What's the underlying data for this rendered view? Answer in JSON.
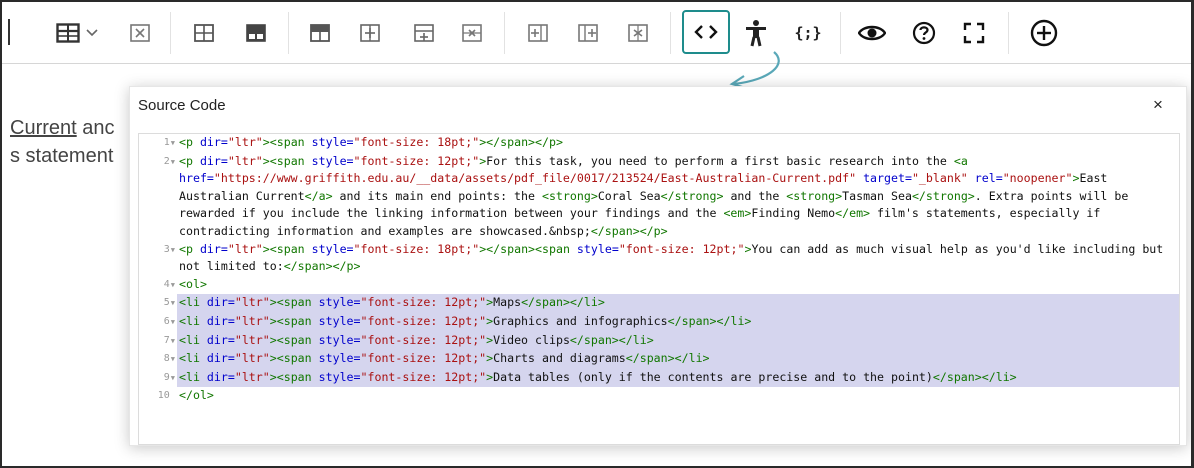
{
  "toolbar": {
    "buttons": [
      {
        "name": "table-icon",
        "title": "Table"
      },
      {
        "name": "delete-table-icon",
        "title": "Delete table"
      },
      {
        "name": "table-cell-properties-icon",
        "title": "Cell properties"
      },
      {
        "name": "table-merge-cells-icon",
        "title": "Merge cells"
      },
      {
        "name": "table-insert-row-before-icon",
        "title": "Insert row before"
      },
      {
        "name": "table-insert-row-after-icon",
        "title": "Insert row after"
      },
      {
        "name": "table-split-cells-icon",
        "title": "Split cells"
      },
      {
        "name": "table-delete-row-icon",
        "title": "Delete row"
      },
      {
        "name": "table-insert-column-before-icon",
        "title": "Insert column before"
      },
      {
        "name": "table-insert-column-after-icon",
        "title": "Insert column after"
      },
      {
        "name": "table-delete-column-icon",
        "title": "Delete column"
      },
      {
        "name": "source-code-icon",
        "title": "Source code"
      },
      {
        "name": "accessibility-icon",
        "title": "Accessibility"
      },
      {
        "name": "code-sample-icon",
        "title": "Code sample"
      },
      {
        "name": "preview-icon",
        "title": "Preview"
      },
      {
        "name": "help-icon",
        "title": "Help"
      },
      {
        "name": "fullscreen-icon",
        "title": "Fullscreen"
      },
      {
        "name": "add-icon",
        "title": "More"
      }
    ],
    "code_sample_label": "{;}"
  },
  "editor": {
    "line1_link": "Current",
    "line1_rest": " anc",
    "line2": "s statement"
  },
  "dialog": {
    "title": "Source Code",
    "close_label": "×"
  },
  "code_lines": [
    {
      "num": "1",
      "fold": true,
      "selected": false,
      "tokens": [
        [
          "tag",
          "<p "
        ],
        [
          "attr",
          "dir="
        ],
        [
          "str",
          "\"ltr\""
        ],
        [
          "tag",
          "><span "
        ],
        [
          "attr",
          "style="
        ],
        [
          "str",
          "\"font-size: 18pt;\""
        ],
        [
          "tag",
          "></span></p>"
        ]
      ]
    },
    {
      "num": "2",
      "fold": true,
      "selected": false,
      "tokens": [
        [
          "tag",
          "<p "
        ],
        [
          "attr",
          "dir="
        ],
        [
          "str",
          "\"ltr\""
        ],
        [
          "tag",
          "><span "
        ],
        [
          "attr",
          "style="
        ],
        [
          "str",
          "\"font-size: 12pt;\""
        ],
        [
          "tag",
          ">"
        ],
        [
          "text",
          "For this task, you need to perform a first basic research into the "
        ],
        [
          "tag",
          "<a "
        ],
        [
          "attr",
          "href="
        ],
        [
          "str",
          "\"https://www.griffith.edu.au/__data/assets/pdf_file/0017/213524/East-Australian-Current.pdf\""
        ],
        [
          "text",
          " "
        ],
        [
          "attr",
          "target="
        ],
        [
          "str",
          "\"_blank\""
        ],
        [
          "text",
          " "
        ],
        [
          "attr",
          "rel="
        ],
        [
          "str",
          "\"noopener\""
        ],
        [
          "tag",
          ">"
        ],
        [
          "text",
          "East Australian Current"
        ],
        [
          "tag",
          "</a>"
        ],
        [
          "text",
          " and its main end points: the "
        ],
        [
          "tag",
          "<strong>"
        ],
        [
          "text",
          "Coral Sea"
        ],
        [
          "tag",
          "</strong>"
        ],
        [
          "text",
          " and the "
        ],
        [
          "tag",
          "<strong>"
        ],
        [
          "text",
          "Tasman Sea"
        ],
        [
          "tag",
          "</strong>"
        ],
        [
          "text",
          ". Extra points will be rewarded if you include the linking information between your findings and the "
        ],
        [
          "tag",
          "<em>"
        ],
        [
          "text",
          "Finding Nemo"
        ],
        [
          "tag",
          "</em>"
        ],
        [
          "text",
          " film's statements, especially if contradicting information and examples are showcased.&nbsp;"
        ],
        [
          "tag",
          "</span></p>"
        ]
      ]
    },
    {
      "num": "3",
      "fold": true,
      "selected": false,
      "tokens": [
        [
          "tag",
          "<p "
        ],
        [
          "attr",
          "dir="
        ],
        [
          "str",
          "\"ltr\""
        ],
        [
          "tag",
          "><span "
        ],
        [
          "attr",
          "style="
        ],
        [
          "str",
          "\"font-size: 18pt;\""
        ],
        [
          "tag",
          "></span><span "
        ],
        [
          "attr",
          "style="
        ],
        [
          "str",
          "\"font-size: 12pt;\""
        ],
        [
          "tag",
          ">"
        ],
        [
          "text",
          "You can add as much visual help as you'd like including but not limited to:"
        ],
        [
          "tag",
          "</span></p>"
        ]
      ]
    },
    {
      "num": "4",
      "fold": true,
      "selected": false,
      "tokens": [
        [
          "tag",
          "<ol>"
        ]
      ]
    },
    {
      "num": "5",
      "fold": true,
      "selected": true,
      "tokens": [
        [
          "tag",
          "<li "
        ],
        [
          "attr",
          "dir="
        ],
        [
          "str",
          "\"ltr\""
        ],
        [
          "tag",
          "><span "
        ],
        [
          "attr",
          "style="
        ],
        [
          "str",
          "\"font-size: 12pt;\""
        ],
        [
          "tag",
          ">"
        ],
        [
          "text",
          "Maps"
        ],
        [
          "tag",
          "</span></li>"
        ]
      ]
    },
    {
      "num": "6",
      "fold": true,
      "selected": true,
      "tokens": [
        [
          "tag",
          "<li "
        ],
        [
          "attr",
          "dir="
        ],
        [
          "str",
          "\"ltr\""
        ],
        [
          "tag",
          "><span "
        ],
        [
          "attr",
          "style="
        ],
        [
          "str",
          "\"font-size: 12pt;\""
        ],
        [
          "tag",
          ">"
        ],
        [
          "text",
          "Graphics and infographics"
        ],
        [
          "tag",
          "</span></li>"
        ]
      ]
    },
    {
      "num": "7",
      "fold": true,
      "selected": true,
      "tokens": [
        [
          "tag",
          "<li "
        ],
        [
          "attr",
          "dir="
        ],
        [
          "str",
          "\"ltr\""
        ],
        [
          "tag",
          "><span "
        ],
        [
          "attr",
          "style="
        ],
        [
          "str",
          "\"font-size: 12pt;\""
        ],
        [
          "tag",
          ">"
        ],
        [
          "text",
          "Video clips"
        ],
        [
          "tag",
          "</span></li>"
        ]
      ]
    },
    {
      "num": "8",
      "fold": true,
      "selected": true,
      "tokens": [
        [
          "tag",
          "<li "
        ],
        [
          "attr",
          "dir="
        ],
        [
          "str",
          "\"ltr\""
        ],
        [
          "tag",
          "><span "
        ],
        [
          "attr",
          "style="
        ],
        [
          "str",
          "\"font-size: 12pt;\""
        ],
        [
          "tag",
          ">"
        ],
        [
          "text",
          "Charts and diagrams"
        ],
        [
          "tag",
          "</span></li>"
        ]
      ]
    },
    {
      "num": "9",
      "fold": true,
      "selected": true,
      "tokens": [
        [
          "tag",
          "<li "
        ],
        [
          "attr",
          "dir="
        ],
        [
          "str",
          "\"ltr\""
        ],
        [
          "tag",
          "><span "
        ],
        [
          "attr",
          "style="
        ],
        [
          "str",
          "\"font-size: 12pt;\""
        ],
        [
          "tag",
          ">"
        ],
        [
          "text",
          "Data tables (only if the contents are precise and to the point)"
        ],
        [
          "tag",
          "</span></li>"
        ]
      ]
    },
    {
      "num": "10",
      "fold": false,
      "selected": false,
      "tokens": [
        [
          "tag",
          "</ol>"
        ]
      ]
    }
  ],
  "colors": {
    "active_outline": "#1e8c8c",
    "selection": "#d5d5ee",
    "tag": "#117700",
    "attr": "#0000cc",
    "string": "#aa1111"
  }
}
